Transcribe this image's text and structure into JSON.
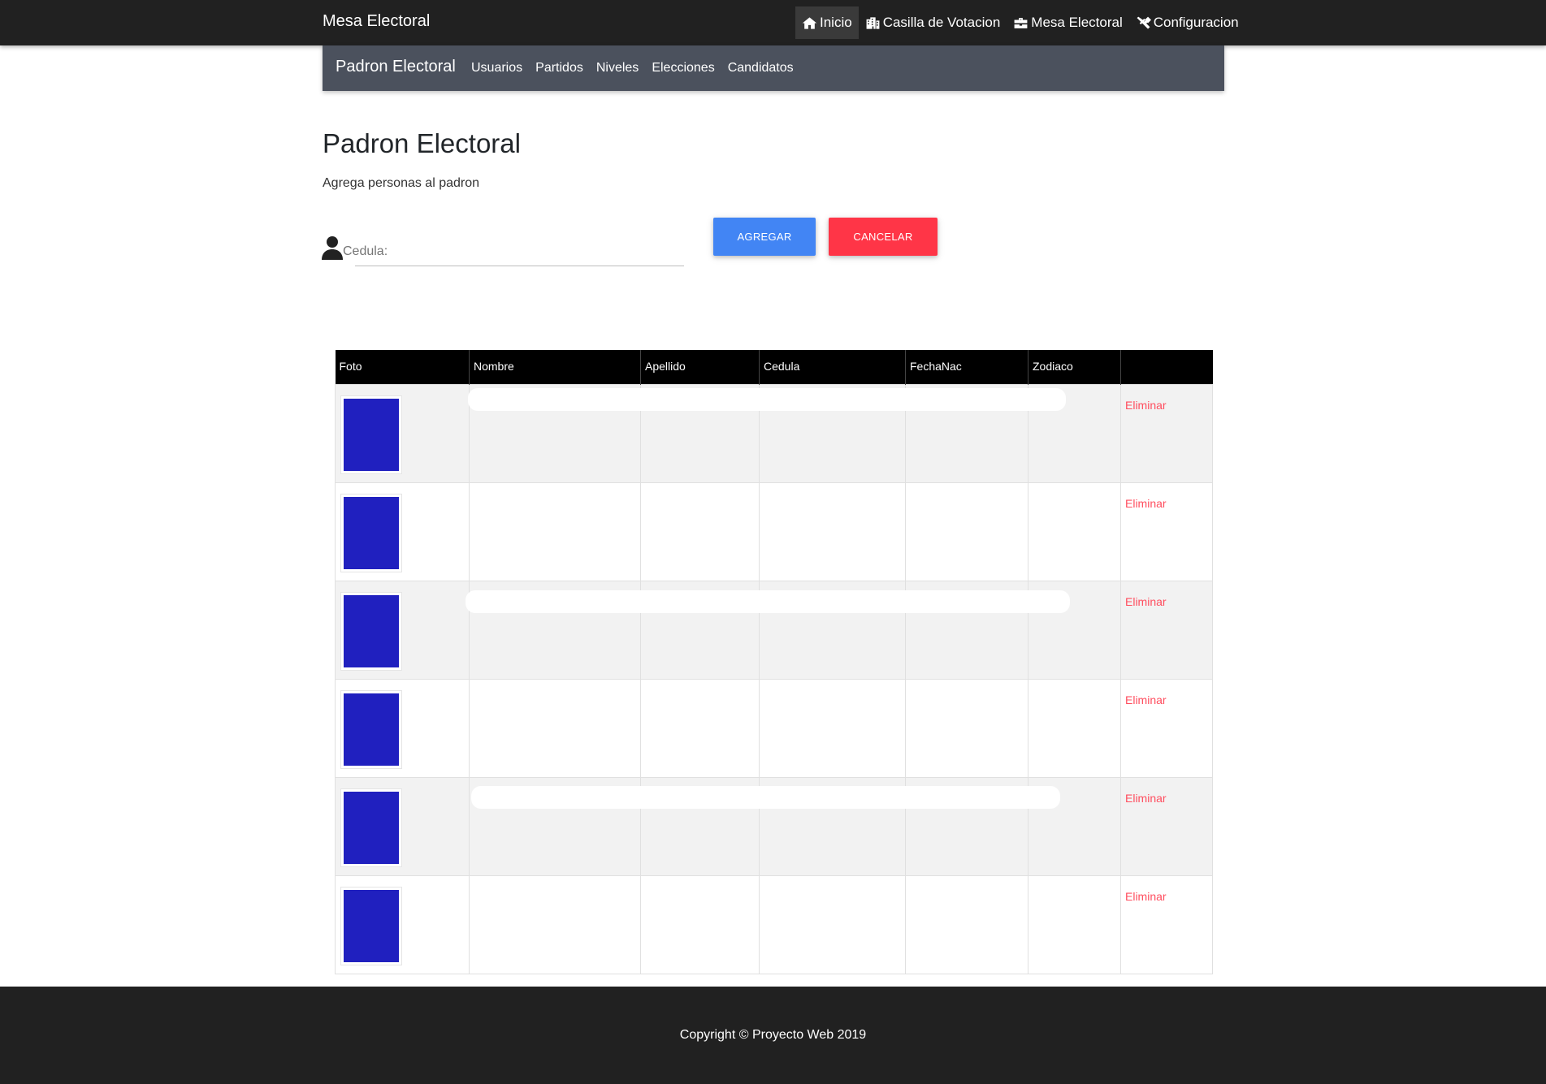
{
  "topbar": {
    "brand": "Mesa Electoral",
    "nav": [
      {
        "label": "Inicio",
        "icon": "home-icon",
        "active": true
      },
      {
        "label": "Casilla de Votacion",
        "icon": "building-icon",
        "active": false
      },
      {
        "label": "Mesa Electoral",
        "icon": "briefcase-icon",
        "active": false
      },
      {
        "label": "Configuracion",
        "icon": "tools-icon",
        "active": false
      }
    ]
  },
  "subbar": {
    "brand": "Padron Electoral",
    "nav": [
      "Usuarios",
      "Partidos",
      "Niveles",
      "Elecciones",
      "Candidatos"
    ]
  },
  "page": {
    "title": "Padron Electoral",
    "subtitle": "Agrega personas al padron"
  },
  "form": {
    "cedula_label": "Cedula:",
    "cedula_value": "",
    "add_label": "Agregar",
    "cancel_label": "Cancelar"
  },
  "table": {
    "headers": [
      "Foto",
      "Nombre",
      "Apellido",
      "Cedula",
      "FechaNac",
      "Zodiaco",
      ""
    ],
    "rows": [
      {
        "nombre": "",
        "apellido": "",
        "cedula": "",
        "fechanac": "",
        "zodiaco": "",
        "action": "Eliminar"
      },
      {
        "nombre": "",
        "apellido": "",
        "cedula": "",
        "fechanac": "",
        "zodiaco": "",
        "action": "Eliminar"
      },
      {
        "nombre": "",
        "apellido": "",
        "cedula": "",
        "fechanac": "",
        "zodiaco": "",
        "action": "Eliminar"
      },
      {
        "nombre": "",
        "apellido": "",
        "cedula": "",
        "fechanac": "",
        "zodiaco": "",
        "action": "Eliminar"
      },
      {
        "nombre": "",
        "apellido": "",
        "cedula": "",
        "fechanac": "",
        "zodiaco": "",
        "action": "Eliminar"
      },
      {
        "nombre": "",
        "apellido": "",
        "cedula": "",
        "fechanac": "",
        "zodiaco": "",
        "action": "Eliminar"
      }
    ]
  },
  "footer": {
    "copyright": "Copyright © Proyecto Web 2019"
  },
  "colors": {
    "topbar": "#212121",
    "subbar": "#4b515d",
    "add_button": "#4285f4",
    "cancel_button": "#ff3547",
    "delete_link": "#ff4d5e",
    "photo": "#2020bf"
  }
}
